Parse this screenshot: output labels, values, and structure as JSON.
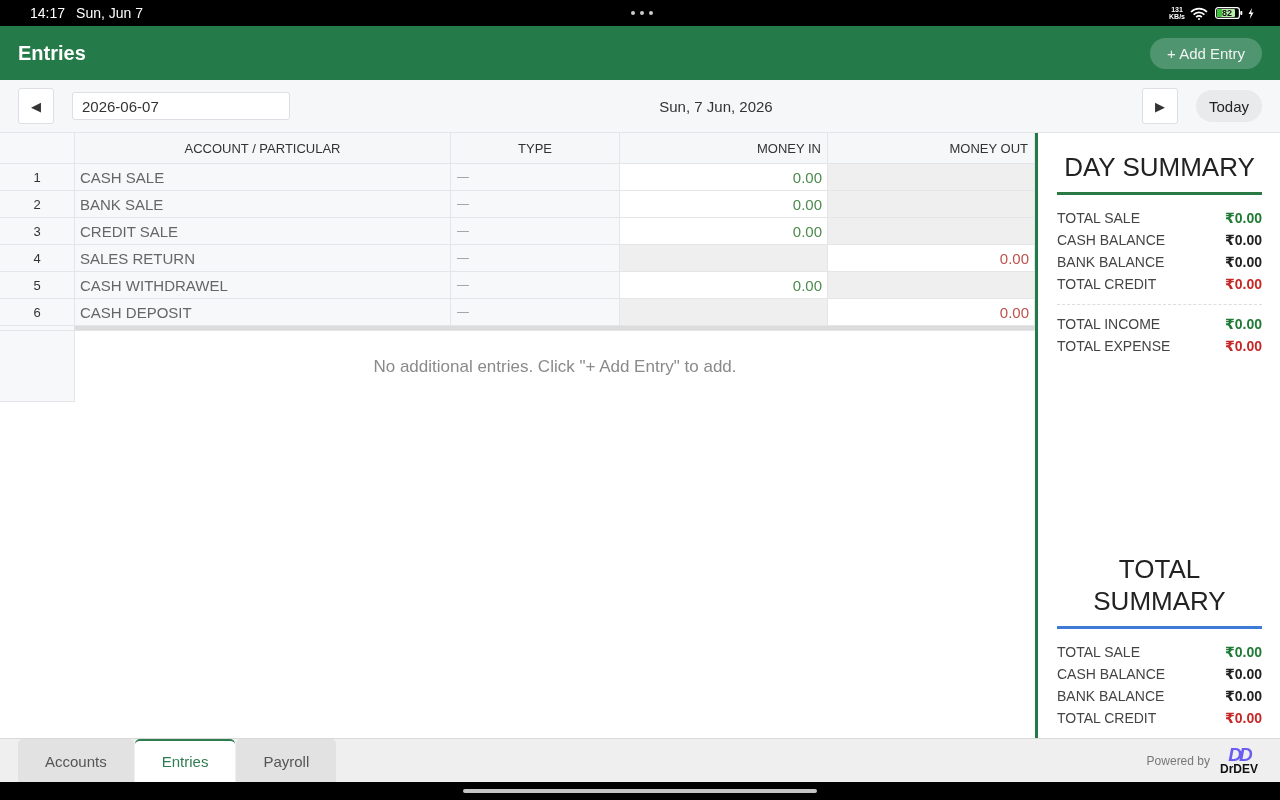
{
  "status_bar": {
    "time": "14:17",
    "date": "Sun, Jun 7",
    "network_speed": "131",
    "network_unit": "KB/s",
    "battery": "82"
  },
  "header": {
    "title": "Entries",
    "add_button": "+ Add Entry"
  },
  "toolbar": {
    "prev_button": "◀",
    "date_value": "2026-06-07",
    "date_label": "Sun, 7 Jun, 2026",
    "next_button": "▶",
    "today_button": "Today"
  },
  "table": {
    "columns": [
      "ACCOUNT / PARTICULAR",
      "TYPE",
      "MONEY IN",
      "MONEY OUT"
    ],
    "rows": [
      {
        "number": "1",
        "account": "CASH SALE",
        "type": "—",
        "money_in": {
          "disabled": false,
          "value": "0.00"
        },
        "money_out": {
          "disabled": true
        }
      },
      {
        "number": "2",
        "account": "BANK SALE",
        "type": "—",
        "money_in": {
          "disabled": false,
          "value": "0.00"
        },
        "money_out": {
          "disabled": true
        }
      },
      {
        "number": "3",
        "account": "CREDIT SALE",
        "type": "—",
        "money_in": {
          "disabled": false,
          "value": "0.00"
        },
        "money_out": {
          "disabled": true
        }
      },
      {
        "number": "4",
        "account": "SALES RETURN",
        "type": "—",
        "money_in": {
          "disabled": true
        },
        "money_out": {
          "disabled": false,
          "value": "0.00"
        }
      },
      {
        "number": "5",
        "account": "CASH WITHDRAWEL",
        "type": "—",
        "money_in": {
          "disabled": false,
          "value": "0.00"
        },
        "money_out": {
          "disabled": true
        }
      },
      {
        "number": "6",
        "account": "CASH DEPOSIT",
        "type": "—",
        "money_in": {
          "disabled": true
        },
        "money_out": {
          "disabled": false,
          "value": "0.00"
        }
      }
    ],
    "empty_message": "No additional entries. Click \"+ Add Entry\" to add."
  },
  "summaries": [
    {
      "title": "DAY SUMMARY",
      "color": "#2b7a45",
      "sections": [
        {
          "rows": [
            {
              "label": "TOTAL SALE",
              "value": "₹0.00",
              "color": "#1f7a34"
            },
            {
              "label": "CASH BALANCE",
              "value": "₹0.00",
              "color": "#222222"
            },
            {
              "label": "BANK BALANCE",
              "value": "₹0.00",
              "color": "#222222"
            },
            {
              "label": "TOTAL CREDIT",
              "value": "₹0.00",
              "color": "#c62828"
            }
          ]
        },
        {
          "rows": [
            {
              "label": "TOTAL INCOME",
              "value": "₹0.00",
              "color": "#1f7a34"
            },
            {
              "label": "TOTAL EXPENSE",
              "value": "₹0.00",
              "color": "#c62828"
            }
          ]
        }
      ]
    },
    {
      "title": "TOTAL SUMMARY",
      "color": "#3d7bd6",
      "sections": [
        {
          "rows": [
            {
              "label": "TOTAL SALE",
              "value": "₹0.00",
              "color": "#1f7a34"
            },
            {
              "label": "CASH BALANCE",
              "value": "₹0.00",
              "color": "#222222"
            },
            {
              "label": "BANK BALANCE",
              "value": "₹0.00",
              "color": "#222222"
            },
            {
              "label": "TOTAL CREDIT",
              "value": "₹0.00",
              "color": "#c62828"
            }
          ]
        }
      ]
    }
  ],
  "tabs": [
    {
      "label": "Accounts",
      "selected": false
    },
    {
      "label": "Entries",
      "selected": true
    },
    {
      "label": "Payroll",
      "selected": false
    }
  ],
  "footer": {
    "powered_by": "Powered by",
    "brand_mark": "DD",
    "brand_name": "DrDEV"
  }
}
